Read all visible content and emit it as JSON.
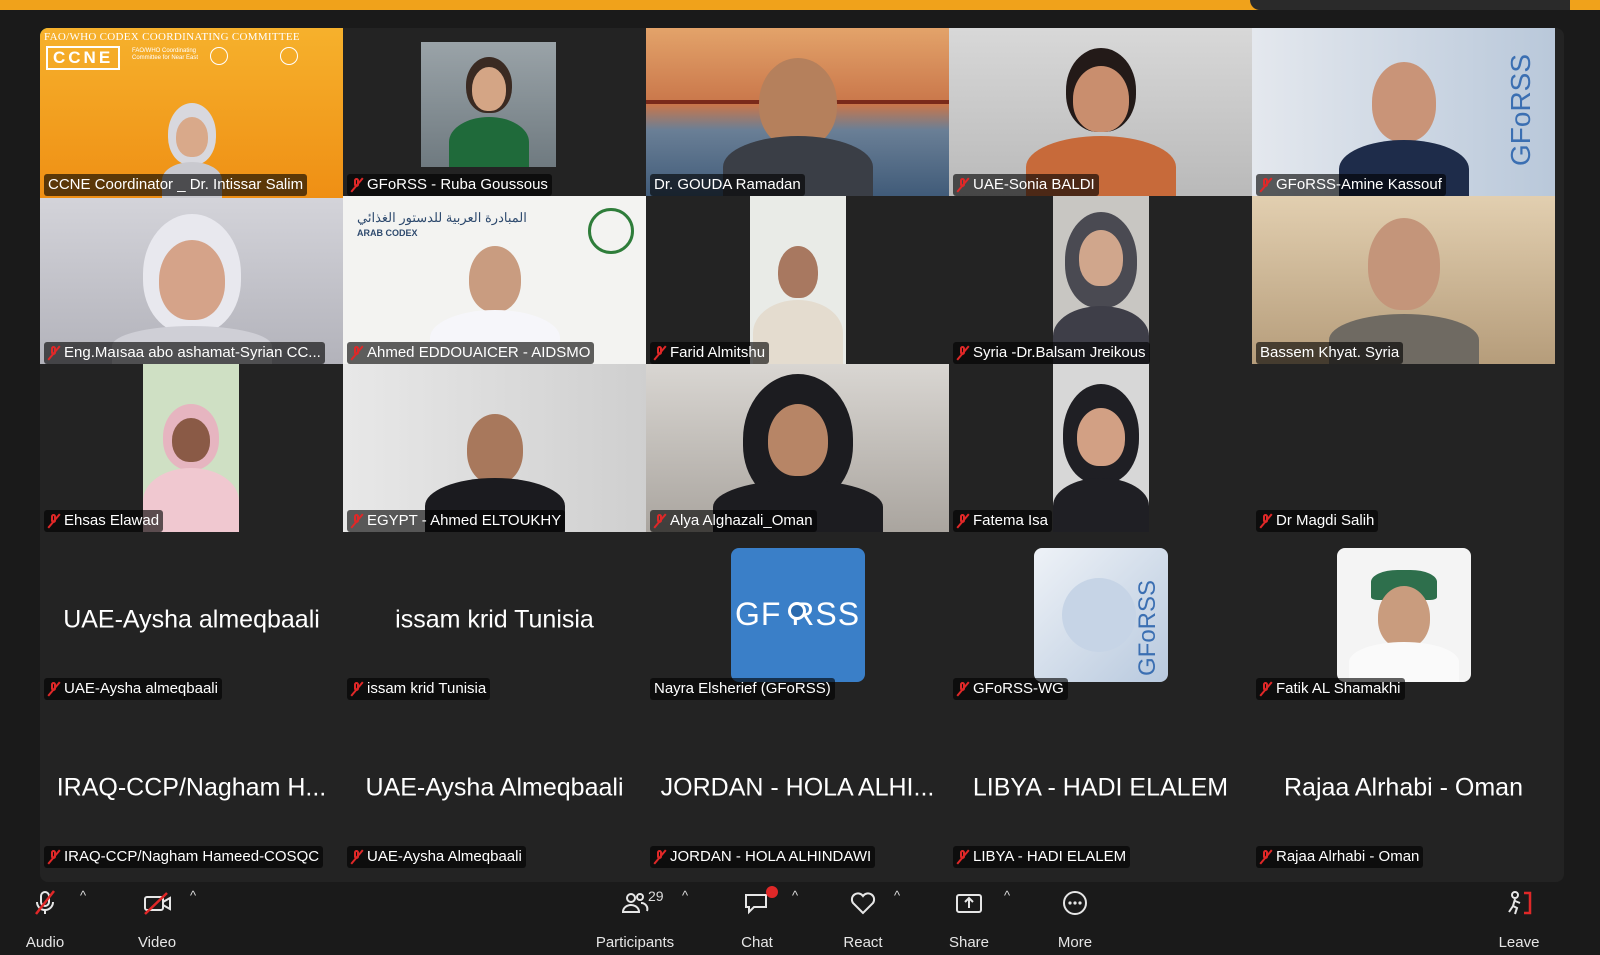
{
  "colors": {
    "accent": "#f0a21b",
    "active_speaker": "#2dbb4a",
    "muted": "#e02828",
    "gforss_blue": "#3a7fc8"
  },
  "ccne_banner": {
    "committee": "FAO/WHO CODEX COORDINATING COMMITTEE",
    "acronym": "CCNE",
    "subtitle": "FAO/WHO Coordinating Committee for Near East"
  },
  "aidsmo_banner": {
    "arabic_text": "المبادرة العربية للدستور الغذائي",
    "brand": "ARAB CODEX"
  },
  "gforss_logo_text": "GF RSS",
  "gforss_vertical_text": "GFoRSS",
  "participants": [
    {
      "name": "CCNE Coordinator _ Dr. Intissar Salim",
      "muted": false,
      "active": true,
      "video": true
    },
    {
      "name": "GFoRSS - Ruba Goussous",
      "muted": true,
      "video": true
    },
    {
      "name": "Dr. GOUDA Ramadan",
      "muted": false,
      "video": true
    },
    {
      "name": "UAE-Sonia BALDI",
      "muted": true,
      "video": true
    },
    {
      "name": "GFoRSS-Amine Kassouf",
      "muted": true,
      "video": true
    },
    {
      "name": "Eng.Maısaa abo ashamat-Syrian CC...",
      "muted": true,
      "video": true
    },
    {
      "name": "Ahmed EDDOUAICER - AIDSMO",
      "muted": true,
      "video": true
    },
    {
      "name": "Farid Almitshu",
      "muted": true,
      "video": true
    },
    {
      "name": "Syria -Dr.Balsam Jreikous",
      "muted": true,
      "video": true
    },
    {
      "name": "Bassem Khyat. Syria",
      "muted": false,
      "video": true
    },
    {
      "name": "Ehsas Elawad",
      "muted": true,
      "video": true
    },
    {
      "name": "EGYPT - Ahmed ELTOUKHY",
      "muted": true,
      "video": true
    },
    {
      "name": "Alya Alghazali_Oman",
      "muted": true,
      "video": true
    },
    {
      "name": "Fatema Isa",
      "muted": true,
      "video": true
    },
    {
      "name": "Dr Magdi Salih",
      "muted": true,
      "video": false
    },
    {
      "name": "UAE-Aysha almeqbaali",
      "display": "UAE-Aysha almeqbaali",
      "muted": true,
      "video": false
    },
    {
      "name": "issam krid Tunisia",
      "display": "issam krid Tunisia",
      "muted": true,
      "video": false
    },
    {
      "name": "Nayra Elsherief (GFoRSS)",
      "muted": false,
      "video": false,
      "avatar": "gforss-blue"
    },
    {
      "name": "GFoRSS-WG",
      "muted": true,
      "video": false,
      "avatar": "gforss-globe"
    },
    {
      "name": "Fatik AL Shamakhi",
      "muted": true,
      "video": false,
      "avatar": "photo"
    },
    {
      "name": "IRAQ-CCP/Nagham Hameed-COSQC",
      "display": "IRAQ-CCP/Nagham H...",
      "muted": true,
      "video": false
    },
    {
      "name": "UAE-Aysha Almeqbaali",
      "display": "UAE-Aysha Almeqbaali",
      "muted": true,
      "video": false
    },
    {
      "name": "JORDAN - HOLA ALHINDAWI",
      "display": "JORDAN - HOLA ALHI...",
      "muted": true,
      "video": false
    },
    {
      "name": "LIBYA - HADI ELALEM",
      "display": "LIBYA - HADI ELALEM",
      "muted": true,
      "video": false
    },
    {
      "name": "Rajaa Alrhabi - Oman",
      "display": "Rajaa Alrhabi - Oman",
      "muted": true,
      "video": false
    }
  ],
  "toolbar": {
    "audio": "Audio",
    "video": "Video",
    "participants": "Participants",
    "participants_count": "29",
    "chat": "Chat",
    "react": "React",
    "share": "Share",
    "more": "More",
    "leave": "Leave",
    "caret": "^"
  }
}
